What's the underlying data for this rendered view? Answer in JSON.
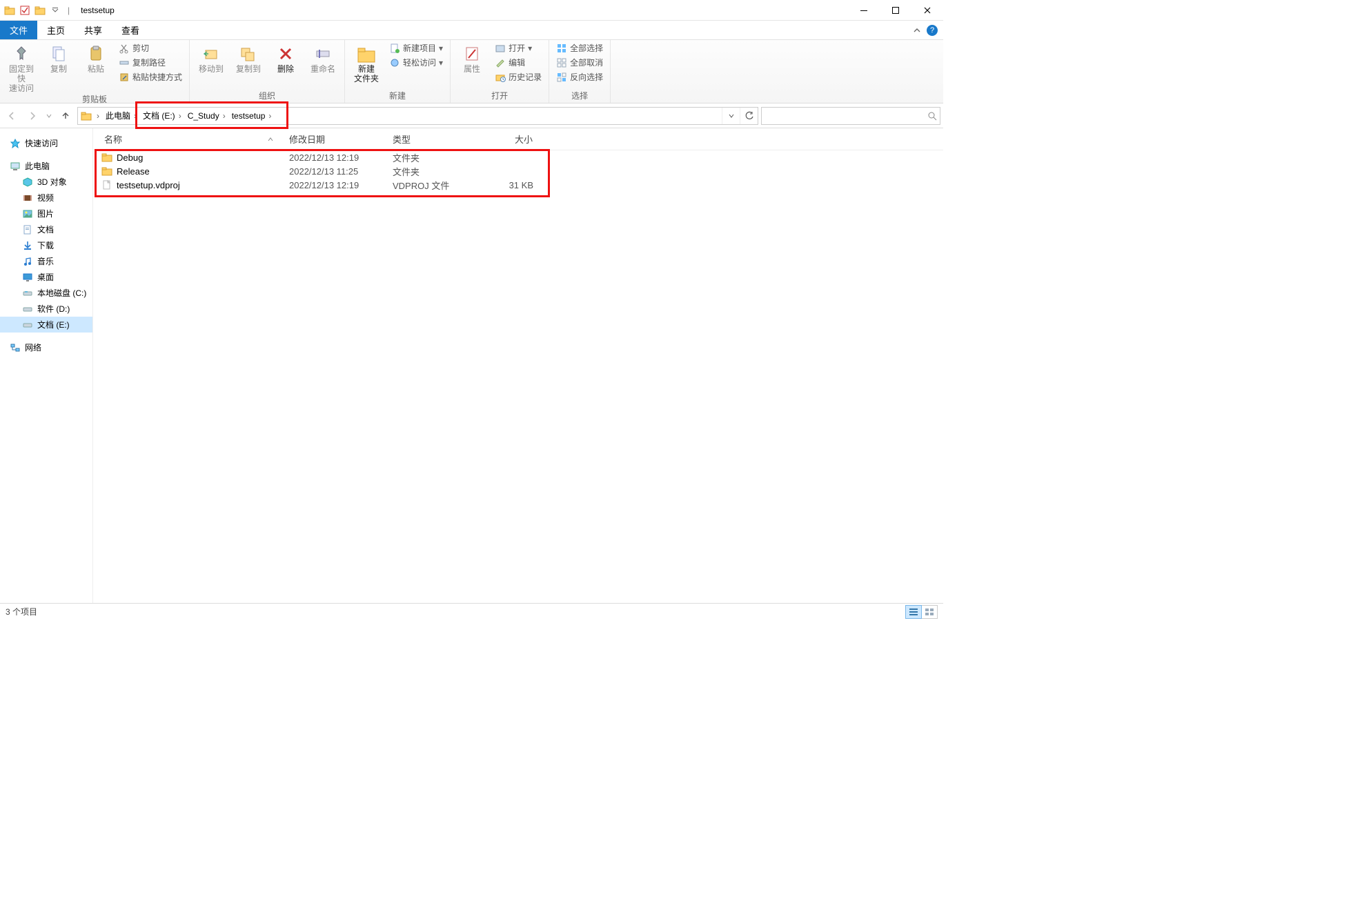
{
  "title": "testsetup",
  "tabs": {
    "file": "文件",
    "home": "主页",
    "share": "共享",
    "view": "查看"
  },
  "ribbon": {
    "clipboard": {
      "pin": "固定到快\n速访问",
      "copy": "复制",
      "paste": "粘贴",
      "cut": "剪切",
      "copy_path": "复制路径",
      "paste_shortcut": "粘贴快捷方式",
      "label": "剪贴板"
    },
    "organize": {
      "move_to": "移动到",
      "copy_to": "复制到",
      "delete": "删除",
      "rename": "重命名",
      "label": "组织"
    },
    "new": {
      "new_folder": "新建\n文件夹",
      "new_item": "新建项目",
      "easy_access": "轻松访问",
      "label": "新建"
    },
    "open": {
      "properties": "属性",
      "open": "打开",
      "edit": "编辑",
      "history": "历史记录",
      "label": "打开"
    },
    "select": {
      "select_all": "全部选择",
      "select_none": "全部取消",
      "invert": "反向选择",
      "label": "选择"
    }
  },
  "breadcrumb": {
    "this_pc": "此电脑",
    "drive": "文档 (E:)",
    "folder1": "C_Study",
    "folder2": "testsetup"
  },
  "columns": {
    "name": "名称",
    "date": "修改日期",
    "type": "类型",
    "size": "大小"
  },
  "files": [
    {
      "name": "Debug",
      "date": "2022/12/13 12:19",
      "type": "文件夹",
      "size": "",
      "icon": "folder"
    },
    {
      "name": "Release",
      "date": "2022/12/13 11:25",
      "type": "文件夹",
      "size": "",
      "icon": "folder"
    },
    {
      "name": "testsetup.vdproj",
      "date": "2022/12/13 12:19",
      "type": "VDPROJ 文件",
      "size": "31 KB",
      "icon": "file"
    }
  ],
  "nav": {
    "quick_access": "快速访问",
    "this_pc": "此电脑",
    "objects3d": "3D 对象",
    "videos": "视频",
    "pictures": "图片",
    "documents": "文档",
    "downloads": "下载",
    "music": "音乐",
    "desktop": "桌面",
    "local_c": "本地磁盘 (C:)",
    "soft_d": "软件 (D:)",
    "doc_e": "文档 (E:)",
    "network": "网络"
  },
  "status": "3 个项目"
}
